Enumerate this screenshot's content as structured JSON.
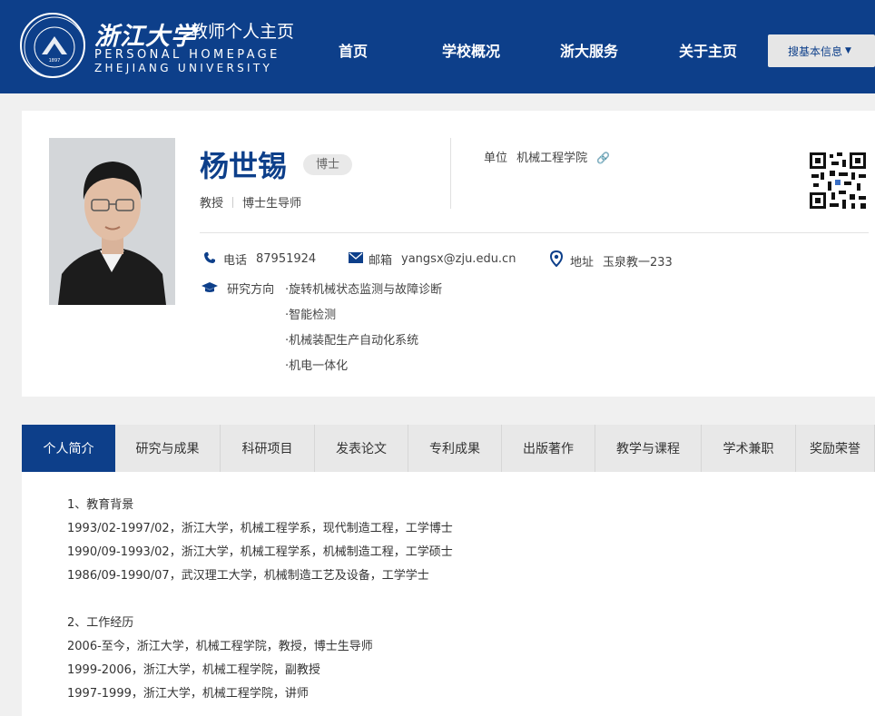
{
  "header": {
    "logo_text": "浙江大学",
    "brand_cn": "浙江大学",
    "brand_sub": "教师个人主页",
    "brand_en_line1": "PERSONAL HOMEPAGE",
    "brand_en_line2": "ZHEJIANG UNIVERSITY",
    "nav": [
      "首页",
      "学校概况",
      "浙大服务",
      "关于主页"
    ],
    "search_label": "搜基本信息",
    "accent": "#0d3f8a"
  },
  "profile": {
    "name": "杨世锡",
    "degree": "博士",
    "title": "教授",
    "role": "博士生导师",
    "unit_label": "单位",
    "unit_value": "机械工程学院",
    "phone_label": "电话",
    "phone_value": "87951924",
    "email_label": "邮箱",
    "email_value": "yangsx@zju.edu.cn",
    "address_label": "地址",
    "address_value": "玉泉教一233",
    "research_label": "研究方向",
    "research": [
      "·旋转机械状态监测与故障诊断",
      "·智能检测",
      "·机械装配生产自动化系统",
      "·机电一体化"
    ]
  },
  "tabs": [
    "个人简介",
    "研究与成果",
    "科研项目",
    "发表论文",
    "专利成果",
    "出版著作",
    "教学与课程",
    "学术兼职",
    "奖励荣誉"
  ],
  "active_tab": "个人简介",
  "content": {
    "edu_heading": "1、教育背景",
    "edu": [
      "1993/02-1997/02，浙江大学，机械工程学系，现代制造工程，工学博士",
      "1990/09-1993/02，浙江大学，机械工程学系，机械制造工程，工学硕士",
      "1986/09-1990/07，武汉理工大学，机械制造工艺及设备，工学学士"
    ],
    "work_heading": "2、工作经历",
    "work": [
      "2006-至今，浙江大学，机械工程学院，教授，博士生导师",
      "1999-2006，浙江大学，机械工程学院，副教授",
      "1997-1999，浙江大学，机械工程学院，讲师"
    ]
  }
}
